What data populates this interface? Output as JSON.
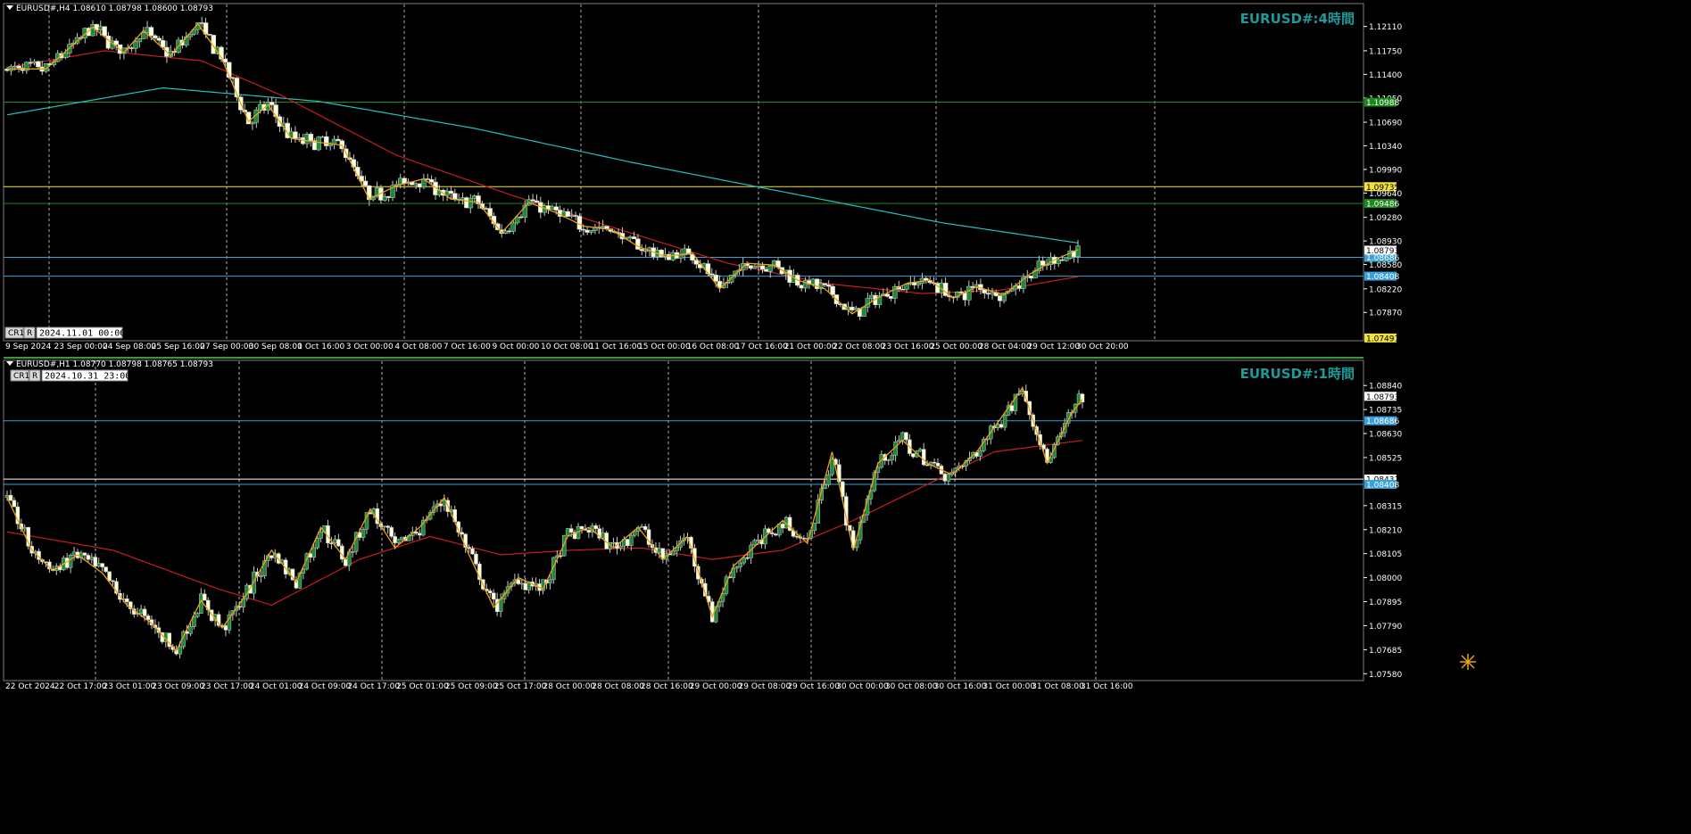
{
  "colors": {
    "background": "#000000",
    "grid": "#d0d0d0",
    "bull_body": "#1d8a3a",
    "bear_body": "#ffffdc",
    "wick": "#c8c8c8",
    "zigzag": "#e8a317",
    "ma_slow": "#22c1c3",
    "ma_fast": "#c81e1e",
    "level_yellow": "#f0e040",
    "level_green": "#1a8a1a",
    "level_cyan": "#3aa0d8",
    "label_teal": "#1d9a9a",
    "axis_text": "#ffffff",
    "panel_border": "#808080",
    "green_separator": "#3a9a3a"
  },
  "chart_data": [
    {
      "type": "candlestick",
      "title": "EURUSD#:4時間",
      "header": "EURUSD#,H4  1.08610 1.08798 1.08600 1.08793",
      "menu_icon": "triangle-down-icon",
      "buttons": [
        "CR1",
        "R"
      ],
      "date_box": "2024.11.01 00:00",
      "ylim": [
        1.0745,
        1.1245
      ],
      "yticks": [
        "1.12110",
        "1.11750",
        "1.11400",
        "1.11050",
        "1.10690",
        "1.10340",
        "1.09990",
        "1.09640",
        "1.09280",
        "1.08930",
        "1.08580",
        "1.08220",
        "1.07870"
      ],
      "xticks": [
        "9 Sep 2024",
        "23 Sep 00:00",
        "24 Sep 08:00",
        "25 Sep 16:00",
        "27 Sep 00:00",
        "30 Sep 08:00",
        "1 Oct 16:00",
        "3 Oct 00:00",
        "4 Oct 08:00",
        "7 Oct 16:00",
        "9 Oct 00:00",
        "10 Oct 08:00",
        "11 Oct 16:00",
        "15 Oct 00:00",
        "16 Oct 08:00",
        "17 Oct 16:00",
        "21 Oct 00:00",
        "22 Oct 08:00",
        "23 Oct 16:00",
        "25 Oct 00:00",
        "28 Oct 04:00",
        "29 Oct 12:00",
        "30 Oct 20:00"
      ],
      "levels": [
        {
          "value": 1.10988,
          "label": "1.10988",
          "color": "green"
        },
        {
          "value": 1.09735,
          "label": "1.09735",
          "color": "yellow"
        },
        {
          "value": 1.09486,
          "label": "1.09486",
          "color": "green"
        },
        {
          "value": 1.08686,
          "label": "1.08686",
          "color": "cyan"
        },
        {
          "value": 1.08408,
          "label": "1.08408",
          "color": "cyan"
        }
      ],
      "price_tags": [
        {
          "value": 1.08793,
          "label": "1.08793",
          "style": "white"
        },
        {
          "value": 1.07491,
          "label": "1.07491",
          "style": "yellow"
        }
      ],
      "zigzag_anchors": [
        [
          0,
          1.1148
        ],
        [
          10,
          1.1148
        ],
        [
          22,
          1.121
        ],
        [
          30,
          1.1172
        ],
        [
          35,
          1.1205
        ],
        [
          42,
          1.1168
        ],
        [
          49,
          1.1215
        ],
        [
          55,
          1.1165
        ],
        [
          62,
          1.107
        ],
        [
          67,
          1.1095
        ],
        [
          73,
          1.1045
        ],
        [
          79,
          1.104
        ],
        [
          86,
          1.1035
        ],
        [
          93,
          1.0955
        ],
        [
          100,
          1.0975
        ],
        [
          107,
          1.0985
        ],
        [
          114,
          1.0955
        ],
        [
          121,
          1.095
        ],
        [
          127,
          1.0905
        ],
        [
          134,
          1.095
        ],
        [
          141,
          1.0935
        ],
        [
          148,
          1.0915
        ],
        [
          155,
          1.091
        ],
        [
          162,
          1.0885
        ],
        [
          169,
          1.087
        ],
        [
          176,
          1.0875
        ],
        [
          183,
          1.0822
        ],
        [
          190,
          1.086
        ],
        [
          197,
          1.0857
        ],
        [
          203,
          1.0835
        ],
        [
          210,
          1.0822
        ],
        [
          217,
          1.0785
        ],
        [
          224,
          1.081
        ],
        [
          231,
          1.083
        ],
        [
          237,
          1.0835
        ],
        [
          243,
          1.0808
        ],
        [
          249,
          1.0825
        ],
        [
          256,
          1.0813
        ],
        [
          263,
          1.0845
        ],
        [
          269,
          1.0865
        ],
        [
          275,
          1.088
        ]
      ],
      "ma_slow": [
        [
          0,
          1.108
        ],
        [
          40,
          1.112
        ],
        [
          80,
          1.11
        ],
        [
          120,
          1.106
        ],
        [
          160,
          1.101
        ],
        [
          200,
          1.0965
        ],
        [
          240,
          1.092
        ],
        [
          275,
          1.089
        ]
      ],
      "ma_fast": [
        [
          0,
          1.115
        ],
        [
          25,
          1.1175
        ],
        [
          50,
          1.116
        ],
        [
          70,
          1.111
        ],
        [
          100,
          1.102
        ],
        [
          130,
          1.096
        ],
        [
          160,
          1.0905
        ],
        [
          185,
          1.086
        ],
        [
          210,
          1.083
        ],
        [
          235,
          1.0815
        ],
        [
          255,
          1.082
        ],
        [
          275,
          1.084
        ]
      ]
    },
    {
      "type": "candlestick",
      "title": "EURUSD#:1時間",
      "header": "EURUSD#,H1  1.08770 1.08798 1.08765 1.08793",
      "menu_icon": "triangle-down-icon",
      "buttons": [
        "CR1",
        "R"
      ],
      "date_box": "2024.10.31 23:00",
      "ylim": [
        1.0755,
        1.0895
      ],
      "yticks": [
        "1.08840",
        "1.08735",
        "1.08630",
        "1.08525",
        "1.08315",
        "1.08210",
        "1.08105",
        "1.08000",
        "1.07895",
        "1.07790",
        "1.07685",
        "1.07580"
      ],
      "xticks": [
        "22 Oct 2024",
        "22 Oct 17:00",
        "23 Oct 01:00",
        "23 Oct 09:00",
        "23 Oct 17:00",
        "24 Oct 01:00",
        "24 Oct 09:00",
        "24 Oct 17:00",
        "25 Oct 01:00",
        "25 Oct 09:00",
        "25 Oct 17:00",
        "28 Oct 00:00",
        "28 Oct 08:00",
        "28 Oct 16:00",
        "29 Oct 00:00",
        "29 Oct 08:00",
        "29 Oct 16:00",
        "30 Oct 00:00",
        "30 Oct 08:00",
        "30 Oct 16:00",
        "31 Oct 00:00",
        "31 Oct 08:00",
        "31 Oct 16:00"
      ],
      "levels": [
        {
          "value": 1.08686,
          "label": "1.08686",
          "color": "cyan"
        },
        {
          "value": 1.08431,
          "label": "1.08431",
          "color": "white"
        },
        {
          "value": 1.08408,
          "label": "1.08408",
          "color": "cyan"
        }
      ],
      "price_tags": [
        {
          "value": 1.08793,
          "label": "1.08793",
          "style": "white"
        }
      ],
      "zigzag_anchors": [
        [
          0,
          1.0835
        ],
        [
          7,
          1.0812
        ],
        [
          13,
          1.0803
        ],
        [
          20,
          1.081
        ],
        [
          27,
          1.0802
        ],
        [
          34,
          1.0788
        ],
        [
          41,
          1.078
        ],
        [
          48,
          1.0768
        ],
        [
          55,
          1.079
        ],
        [
          61,
          1.0778
        ],
        [
          68,
          1.0793
        ],
        [
          75,
          1.0812
        ],
        [
          82,
          1.0798
        ],
        [
          89,
          1.0822
        ],
        [
          96,
          1.0808
        ],
        [
          103,
          1.083
        ],
        [
          110,
          1.0813
        ],
        [
          117,
          1.0822
        ],
        [
          124,
          1.0835
        ],
        [
          131,
          1.081
        ],
        [
          138,
          1.0787
        ],
        [
          145,
          1.08
        ],
        [
          152,
          1.0795
        ],
        [
          159,
          1.0818
        ],
        [
          165,
          1.0822
        ],
        [
          172,
          1.0813
        ],
        [
          179,
          1.0822
        ],
        [
          186,
          1.0808
        ],
        [
          193,
          1.0818
        ],
        [
          200,
          1.0783
        ],
        [
          206,
          1.0805
        ],
        [
          213,
          1.0815
        ],
        [
          220,
          1.0825
        ],
        [
          227,
          1.0815
        ],
        [
          234,
          1.0855
        ],
        [
          240,
          1.0812
        ],
        [
          247,
          1.085
        ],
        [
          254,
          1.086
        ],
        [
          261,
          1.085
        ],
        [
          268,
          1.0845
        ],
        [
          275,
          1.0855
        ],
        [
          282,
          1.087
        ],
        [
          288,
          1.0883
        ],
        [
          295,
          1.085
        ],
        [
          302,
          1.0872
        ],
        [
          305,
          1.0878
        ]
      ],
      "ma_fast": [
        [
          0,
          1.082
        ],
        [
          30,
          1.0812
        ],
        [
          60,
          1.0795
        ],
        [
          75,
          1.0788
        ],
        [
          100,
          1.0808
        ],
        [
          120,
          1.0818
        ],
        [
          140,
          1.081
        ],
        [
          160,
          1.0812
        ],
        [
          180,
          1.0813
        ],
        [
          200,
          1.0808
        ],
        [
          220,
          1.0812
        ],
        [
          240,
          1.0825
        ],
        [
          260,
          1.084
        ],
        [
          280,
          1.0855
        ],
        [
          305,
          1.086
        ]
      ]
    }
  ],
  "cursor_icon": "crosshair-cursor-icon"
}
